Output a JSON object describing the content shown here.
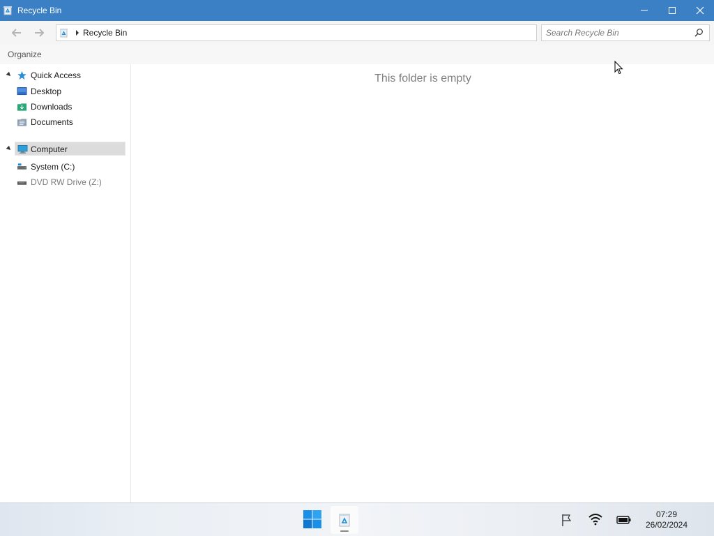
{
  "window": {
    "title": "Recycle Bin",
    "title_bar_color": "#3b7fc4",
    "controls": [
      "minimize-icon",
      "maximize-icon",
      "close-icon"
    ]
  },
  "address_bar": {
    "icon": "recycle-bin-icon",
    "crumbs": [
      "Recycle Bin"
    ]
  },
  "search": {
    "placeholder": "Search Recycle Bin",
    "value": ""
  },
  "command_bar": {
    "organize_label": "Organize"
  },
  "nav_pane": {
    "items": [
      {
        "label": "Quick Access",
        "icon": "star-icon",
        "expanded": true
      },
      {
        "label": "Desktop",
        "icon": "desktop-folder-icon"
      },
      {
        "label": "Downloads",
        "icon": "downloads-folder-icon"
      },
      {
        "label": "Documents",
        "icon": "documents-folder-icon"
      },
      {
        "label": "Computer",
        "icon": "computer-icon",
        "expanded": true,
        "selected": true
      },
      {
        "label": "System (C:)",
        "icon": "drive-icon"
      },
      {
        "label": "DVD RW Drive (Z:)",
        "icon": "dvd-drive-icon",
        "disabled": true
      }
    ]
  },
  "content": {
    "empty_message": "This folder is empty"
  },
  "taskbar": {
    "pinned": [
      "windows-start-icon",
      "recycle-bin-icon"
    ],
    "tray": [
      "flag-icon",
      "wifi-icon",
      "battery-icon"
    ],
    "time": "07:29",
    "date": "26/02/2024"
  }
}
